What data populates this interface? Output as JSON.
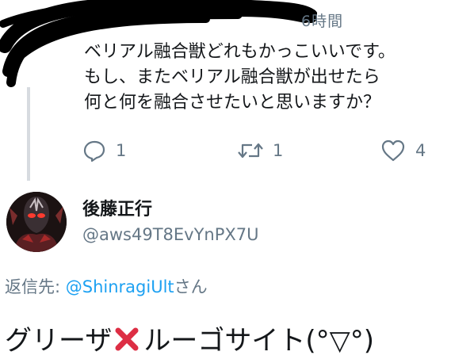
{
  "parent_tweet": {
    "time": "6時間",
    "text": "ベリアル融合獣どれもかっこいいです。\nもし、またベリアル融合獣が出せたら\n何と何を融合させたいと思いますか？",
    "actions": {
      "reply_count": "1",
      "retweet_count": "1",
      "like_count": "4"
    }
  },
  "reply_tweet": {
    "display_name": "後藤正行",
    "handle": "@aws49T8EvYnPX7U",
    "reply_to_prefix": "返信先: ",
    "reply_to_mention": "@ShinragiUlt",
    "reply_to_suffix": "さん",
    "text_before": "グリーザ",
    "cross_emoji": "❌",
    "text_after": "ルーゴサイト(°▽°)"
  },
  "colors": {
    "text": "#14171a",
    "secondary": "#657786",
    "mention": "#1da1f2",
    "thread_line": "#d7dbe0",
    "cross": "#dd2e44"
  },
  "icons": [
    "reply-icon",
    "retweet-icon",
    "like-icon",
    "cross-mark-icon"
  ]
}
